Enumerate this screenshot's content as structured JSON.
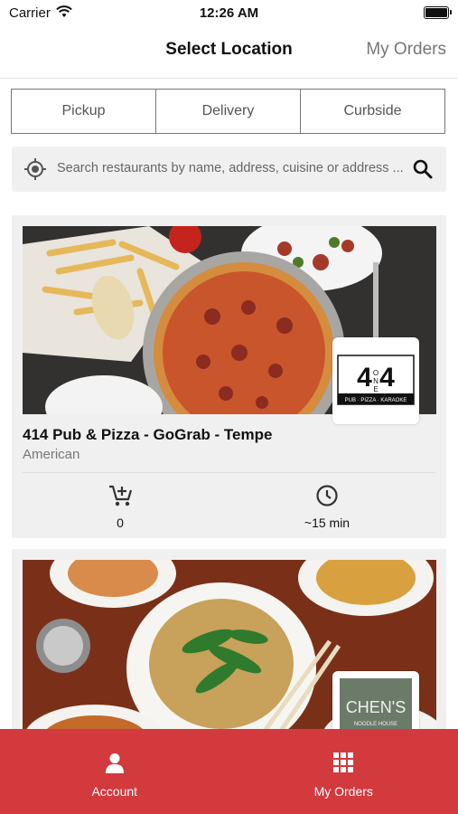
{
  "status_bar": {
    "carrier": "Carrier",
    "time": "12:26 AM"
  },
  "nav": {
    "title": "Select Location",
    "right_action": "My Orders"
  },
  "order_types": [
    "Pickup",
    "Delivery",
    "Curbside"
  ],
  "search": {
    "placeholder": "Search restaurants by name, address, cuisine or address ..."
  },
  "restaurants": [
    {
      "name": "414 Pub & Pizza - GoGrab - Tempe",
      "cuisine": "American",
      "cart_count": "0",
      "wait_time": "~15 min",
      "logo_text": {
        "digits": "414",
        "word": "ONE",
        "tagline": "PUB · PIZZA · KARAOKE"
      }
    },
    {
      "name": "",
      "cuisine": "",
      "logo_text": {
        "title": "CHEN'S",
        "tagline": "NOODLE HOUSE"
      }
    }
  ],
  "tab_bar": {
    "account": "Account",
    "orders": "My Orders"
  },
  "colors": {
    "accent": "#d23a3e",
    "card_bg": "#f0f0f0"
  }
}
